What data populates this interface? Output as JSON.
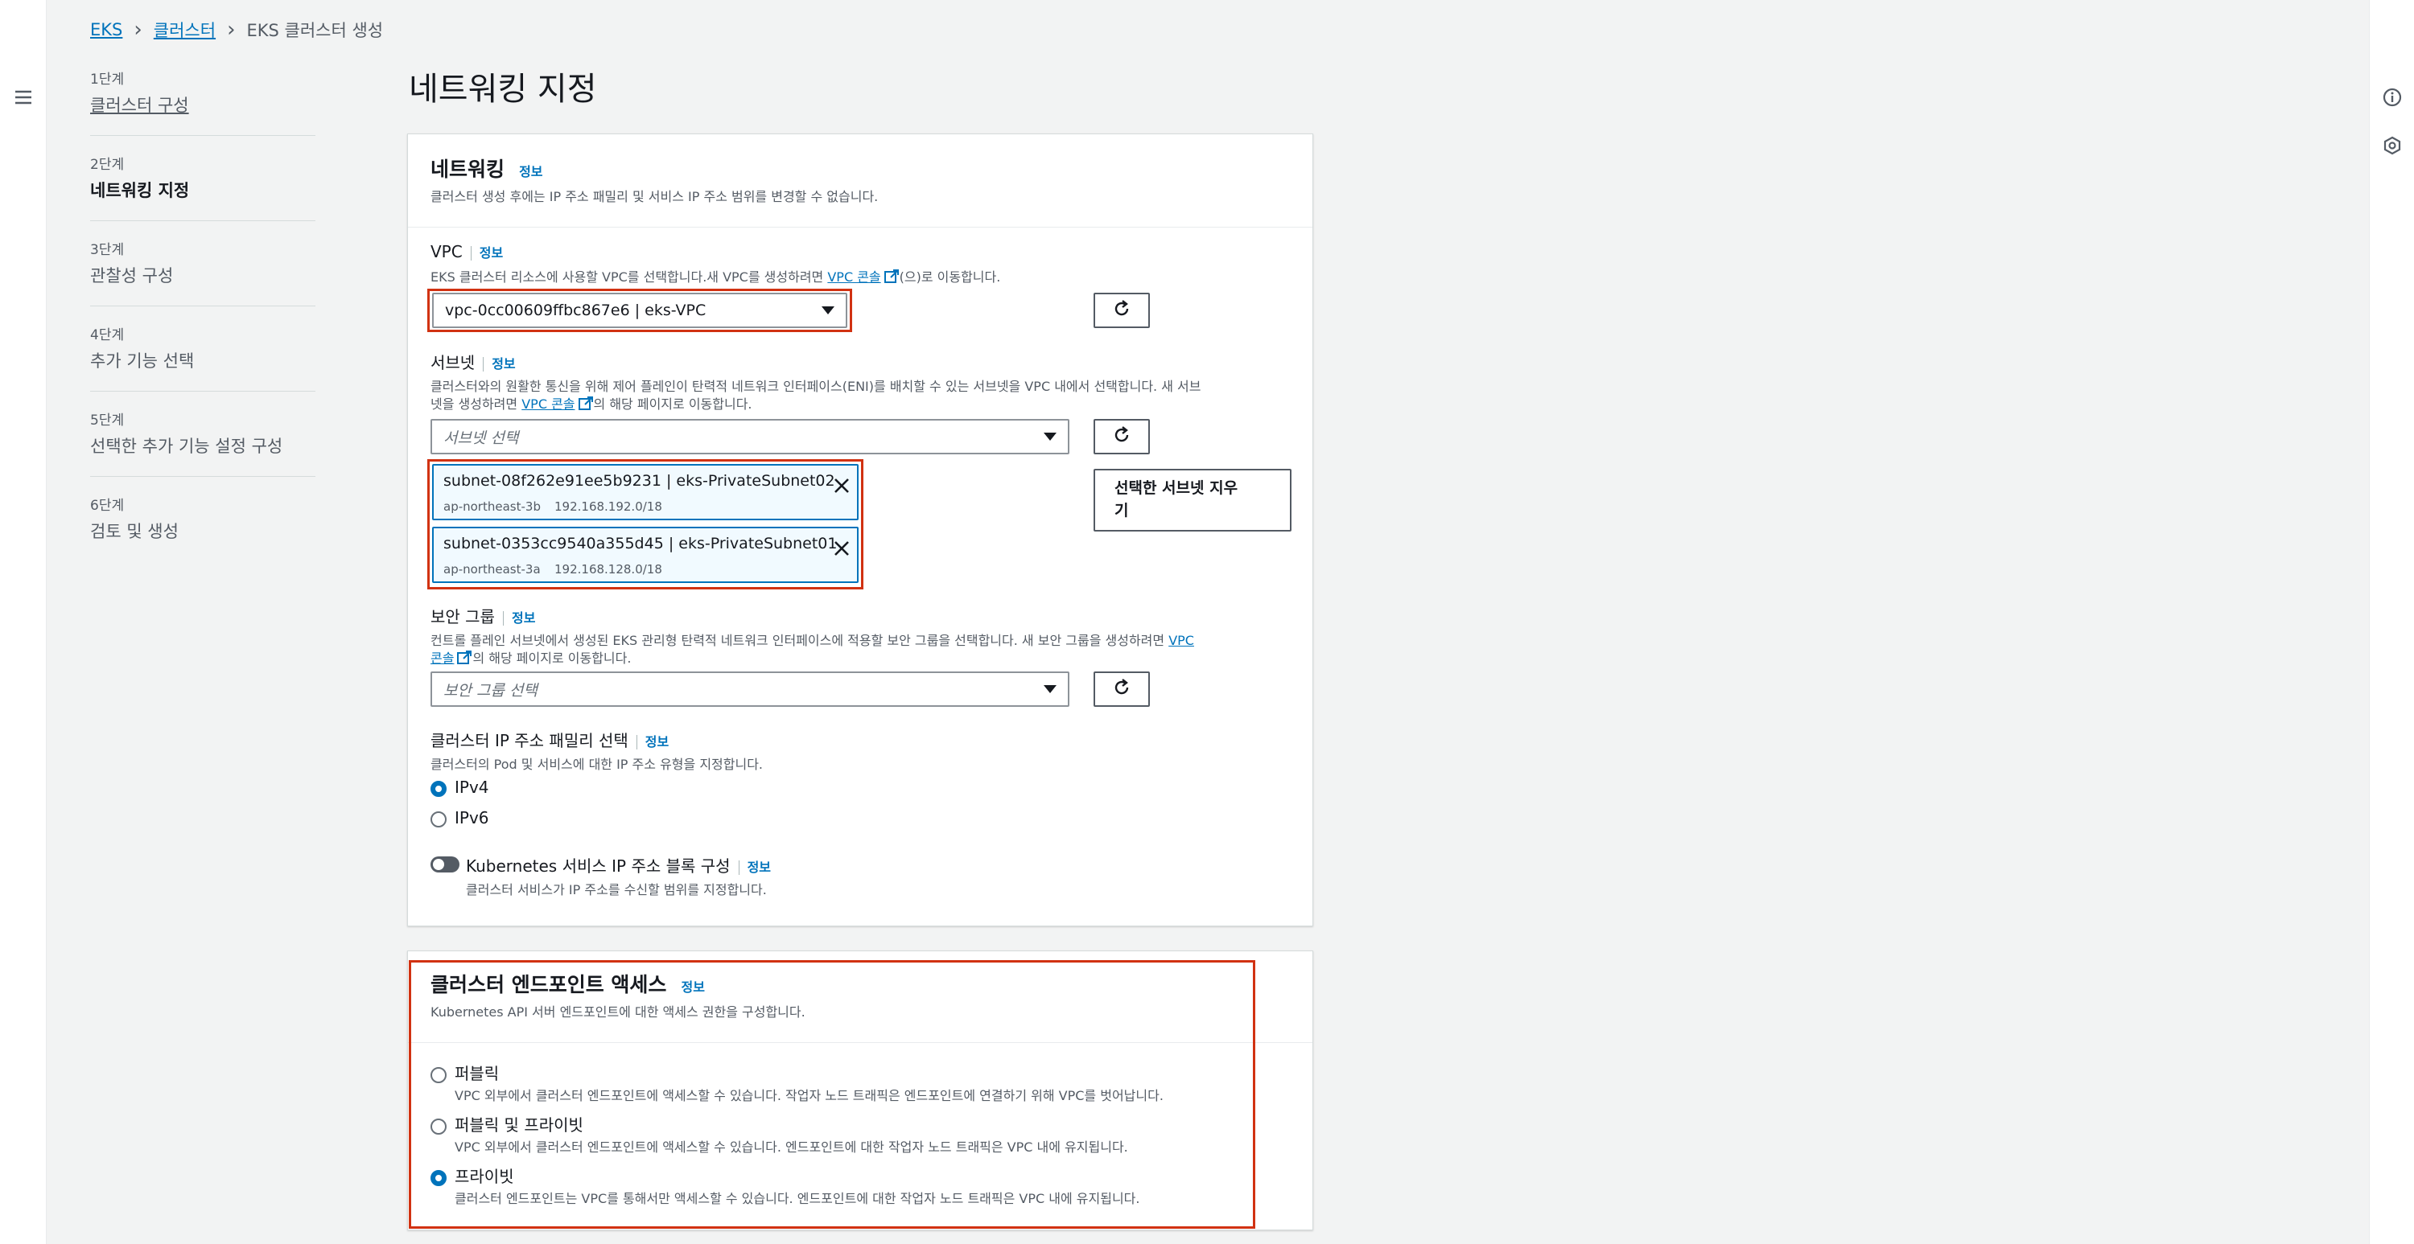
{
  "breadcrumb": {
    "items": [
      "EKS",
      "클러스터"
    ],
    "current": "EKS 클러스터 생성"
  },
  "steps": [
    {
      "num": "1단계",
      "label": "클러스터 구성"
    },
    {
      "num": "2단계",
      "label": "네트워킹 지정"
    },
    {
      "num": "3단계",
      "label": "관찰성 구성"
    },
    {
      "num": "4단계",
      "label": "추가 기능 선택"
    },
    {
      "num": "5단계",
      "label": "선택한 추가 기능 설정 구성"
    },
    {
      "num": "6단계",
      "label": "검토 및 생성"
    }
  ],
  "page_title": "네트워킹 지정",
  "networking": {
    "title": "네트워킹",
    "info": "정보",
    "desc": "클러스터 생성 후에는 IP 주소 패밀리 및 서비스 IP 주소 범위를 변경할 수 없습니다.",
    "vpc": {
      "label": "VPC",
      "info": "정보",
      "desc_before": "EKS 클러스터 리소스에 사용할 VPC를 선택합니다.새 VPC를 생성하려면 ",
      "link": "VPC 콘솔",
      "desc_after": "(으)로 이동합니다.",
      "selected": "vpc-0cc00609ffbc867e6 | eks-VPC"
    },
    "subnets": {
      "label": "서브넷",
      "info": "정보",
      "desc_line1": "클러스터와의 원활한 통신을 위해 제어 플레인이 탄력적 네트워크 인터페이스(ENI)를 배치할 수 있는 서브넷을 VPC 내에서 선택합니다. 새 서브",
      "desc_line2_before": "넷을 생성하려면 ",
      "link": "VPC 콘솔",
      "desc_line2_after": "의 해당 페이지로 이동합니다.",
      "placeholder": "서브넷 선택",
      "tokens": [
        {
          "name": "subnet-08f262e91ee5b9231 | eks-PrivateSubnet02",
          "az": "ap-northeast-3b",
          "cidr": "192.168.192.0/18"
        },
        {
          "name": "subnet-0353cc9540a355d45 | eks-PrivateSubnet01",
          "az": "ap-northeast-3a",
          "cidr": "192.168.128.0/18"
        }
      ],
      "clear_button_line1": "선택한 서브넷 지우",
      "clear_button_line2": "기"
    },
    "security_group": {
      "label": "보안 그룹",
      "info": "정보",
      "desc_line1_before": "컨트롤 플레인 서브넷에서 생성된 EKS 관리형 탄력적 네트워크 인터페이스에 적용할 보안 그룹을 선택합니다. 새 보안 그룹을 생성하려면 ",
      "link_part1": "VPC",
      "link_part2": "콘솔",
      "desc_line2_after": "의 해당 페이지로 이동합니다.",
      "placeholder": "보안 그룹 선택"
    },
    "ip_family": {
      "label": "클러스터 IP 주소 패밀리 선택",
      "info": "정보",
      "desc": "클러스터의 Pod 및 서비스에 대한 IP 주소 유형을 지정합니다.",
      "options": [
        "IPv4",
        "IPv6"
      ],
      "selected": "IPv4"
    },
    "k8s_cidr": {
      "label": "Kubernetes 서비스 IP 주소 블록 구성",
      "info": "정보",
      "desc": "클러스터 서비스가 IP 주소를 수신할 범위를 지정합니다."
    }
  },
  "endpoint": {
    "title": "클러스터 엔드포인트 액세스",
    "info": "정보",
    "desc": "Kubernetes API 서버 엔드포인트에 대한 액세스 권한을 구성합니다.",
    "options": [
      {
        "label": "퍼블릭",
        "desc": "VPC 외부에서 클러스터 엔드포인트에 액세스할 수 있습니다. 작업자 노드 트래픽은 엔드포인트에 연결하기 위해 VPC를 벗어납니다."
      },
      {
        "label": "퍼블릭 및 프라이빗",
        "desc": "VPC 외부에서 클러스터 엔드포인트에 액세스할 수 있습니다. 엔드포인트에 대한 작업자 노드 트래픽은 VPC 내에 유지됩니다."
      },
      {
        "label": "프라이빗",
        "desc": "클러스터 엔드포인트는 VPC를 통해서만 액세스할 수 있습니다. 엔드포인트에 대한 작업자 노드 트래픽은 VPC 내에 유지됩니다."
      }
    ],
    "selected": "프라이빗"
  },
  "icons": {
    "menu": "hamburger-icon",
    "info": "info-circle-icon",
    "gear": "settings-icon",
    "refresh": "refresh-icon",
    "close": "close-icon",
    "external": "external-link-icon"
  },
  "colors": {
    "link": "#0073bb",
    "highlight_border": "#d13212",
    "token_bg": "#f1faff"
  }
}
